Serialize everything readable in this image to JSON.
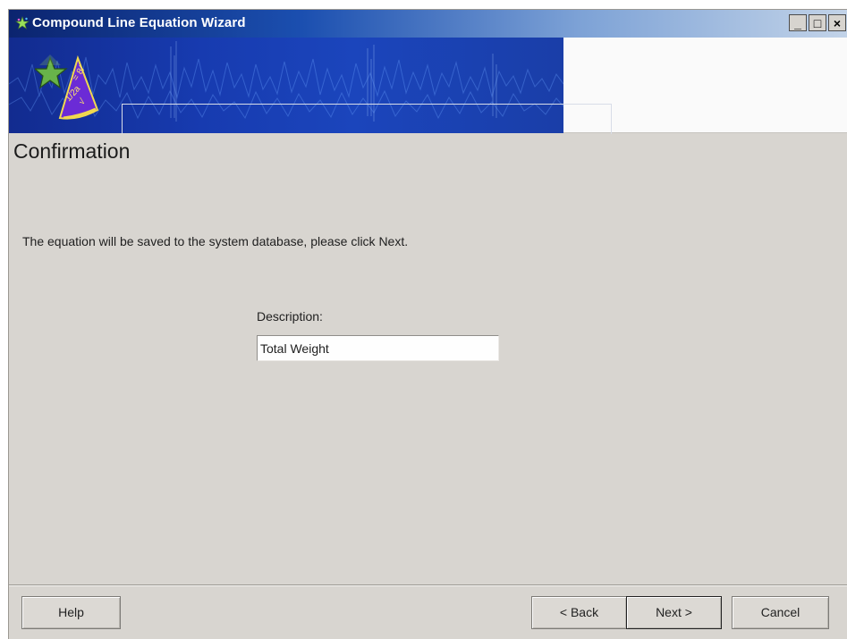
{
  "window": {
    "title": "Compound Line Equation Wizard",
    "controls": {
      "minimize": "_",
      "maximize": "□",
      "close": "×"
    }
  },
  "banner": {
    "icon": "wizard-hat-icon"
  },
  "page": {
    "title": "Confirmation",
    "message": "The equation will be saved to the system database, please click Next."
  },
  "form": {
    "description_label": "Description:",
    "description_value": "Total Weight"
  },
  "buttons": {
    "help": "Help",
    "back": "< Back",
    "next": "Next >",
    "cancel": "Cancel"
  },
  "colors": {
    "titlebar_start": "#0b246f",
    "titlebar_end": "#c2d3e8",
    "banner_blue": "#1b45bc",
    "dialog_background": "#d8d5d0"
  }
}
